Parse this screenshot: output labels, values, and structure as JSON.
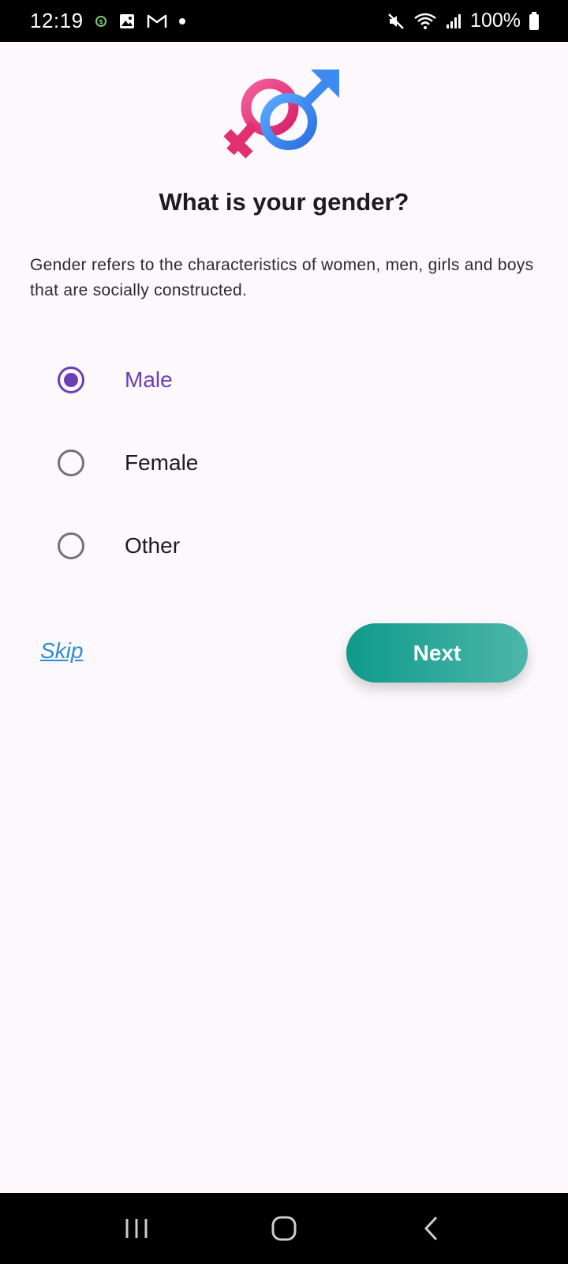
{
  "status_bar": {
    "time": "12:19",
    "battery": "100%",
    "left_icons": [
      "app-icon",
      "image-icon",
      "gmail-icon",
      "dot-icon"
    ],
    "right_icons": [
      "mute-icon",
      "wifi-icon",
      "signal-icon",
      "battery-icon"
    ]
  },
  "screen": {
    "title": "What is your gender?",
    "description": "Gender refers to the characteristics of women, men, girls and boys that are socially constructed.",
    "options": [
      {
        "label": "Male",
        "selected": true
      },
      {
        "label": "Female",
        "selected": false
      },
      {
        "label": "Other",
        "selected": false
      }
    ],
    "skip_label": "Skip",
    "next_label": "Next"
  },
  "colors": {
    "accent": "#6a3fb5",
    "link": "#2a8fd6",
    "button_start": "#0f9a8a",
    "button_end": "#4db6aa",
    "female_symbol": "#e8357e",
    "male_symbol": "#3d8ff0"
  },
  "nav_bar": {
    "buttons": [
      "recent-apps-icon",
      "home-icon",
      "back-icon"
    ]
  }
}
